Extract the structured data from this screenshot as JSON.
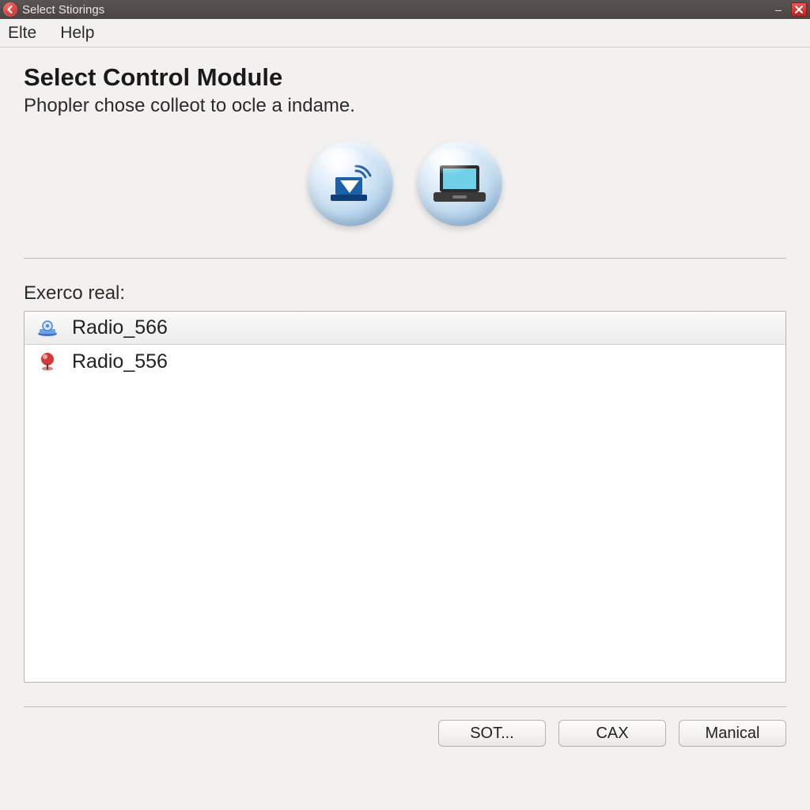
{
  "titlebar": {
    "title": "Select Stiorings"
  },
  "menu": {
    "items": [
      "Elte",
      "Help"
    ]
  },
  "header": {
    "title": "Select Control Module",
    "subtitle": "Phopler chose colleot to ocle a indame."
  },
  "list": {
    "label": "Exerco real:",
    "items": [
      {
        "name": "Radio_566",
        "icon": "device-blue",
        "selected": true
      },
      {
        "name": "Radio_556",
        "icon": "pin-red",
        "selected": false
      }
    ]
  },
  "footer": {
    "buttons": [
      "SOT...",
      "CAX",
      "Manical"
    ]
  }
}
